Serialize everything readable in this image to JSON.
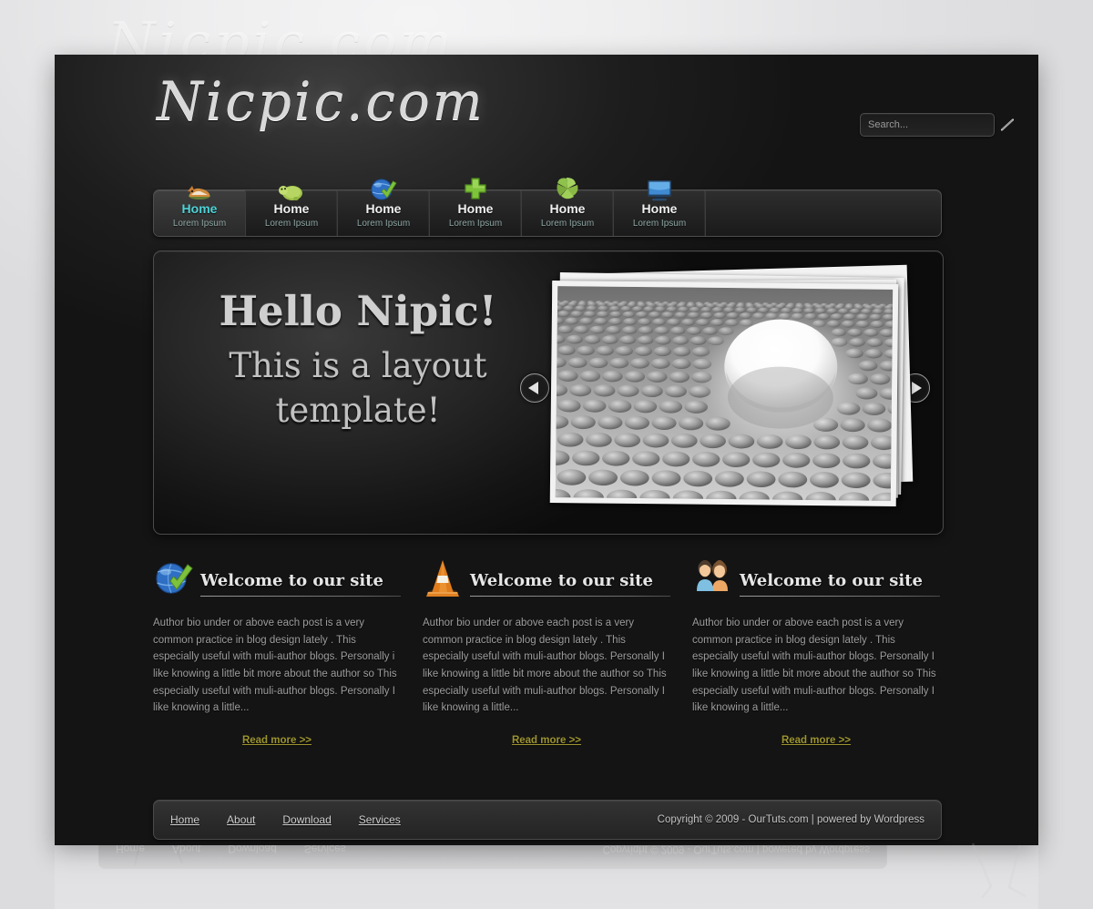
{
  "site": {
    "logo_text": "Nicpic.com",
    "watermark_ghost": "Nicpic.com"
  },
  "search": {
    "placeholder": "Search...",
    "value": "",
    "icon": "magnifier-icon"
  },
  "nav": {
    "items": [
      {
        "title": "Home",
        "subtitle": "Lorem Ipsum",
        "icon": "fox-icon",
        "active": true
      },
      {
        "title": "Home",
        "subtitle": "Lorem Ipsum",
        "icon": "turtle-icon",
        "active": false
      },
      {
        "title": "Home",
        "subtitle": "Lorem Ipsum",
        "icon": "globe-check-icon",
        "active": false
      },
      {
        "title": "Home",
        "subtitle": "Lorem Ipsum",
        "icon": "green-plus-icon",
        "active": false
      },
      {
        "title": "Home",
        "subtitle": "Lorem Ipsum",
        "icon": "green-pinwheel-icon",
        "active": false
      },
      {
        "title": "Home",
        "subtitle": "Lorem Ipsum",
        "icon": "monitor-icon",
        "active": false
      }
    ]
  },
  "hero": {
    "headline": "Hello Nipic!",
    "subline_1": "This is a layout",
    "subline_2": "template!",
    "prev_label": "◀",
    "next_label": "▶",
    "image_alt": "photo-stack-spheres-render"
  },
  "columns": [
    {
      "icon": "globe-check-icon",
      "title": "Welcome to our site",
      "body": "Author bio under or above each post is a very common practice in blog design lately . This especially useful with muli-author blogs. Personally i like knowing a little bit more about the author so This especially useful with muli-author blogs. Personally I like knowing a little...",
      "read_more": "Read more >>"
    },
    {
      "icon": "traffic-cone-icon",
      "title": "Welcome to our site",
      "body": "Author bio under or above each post is a very common practice in blog design lately . This especially useful with muli-author blogs. Personally I like knowing a little bit more about the author so This especially useful with muli-author blogs. Personally I like knowing a little...",
      "read_more": "Read more >>"
    },
    {
      "icon": "users-icon",
      "title": "Welcome to our site",
      "body": "Author bio under or above each post is a very common practice in blog design lately . This especially useful with muli-author blogs. Personally I like knowing a little bit more about the author so This especially useful with muli-author blogs. Personally I like knowing a little...",
      "read_more": "Read more >>"
    }
  ],
  "footer": {
    "links": [
      "Home",
      "About",
      "Download",
      "Services"
    ],
    "copyright": "Copyright © 2009 - OurTuts.com | powered by Wordpress"
  },
  "theme": {
    "accent_cyan": "#4fd3d8",
    "link_olive": "#9c9430",
    "page_bg": "#191919",
    "canvas_bg": "#e3e3e5",
    "nav_sub": "#8fa8a5"
  }
}
